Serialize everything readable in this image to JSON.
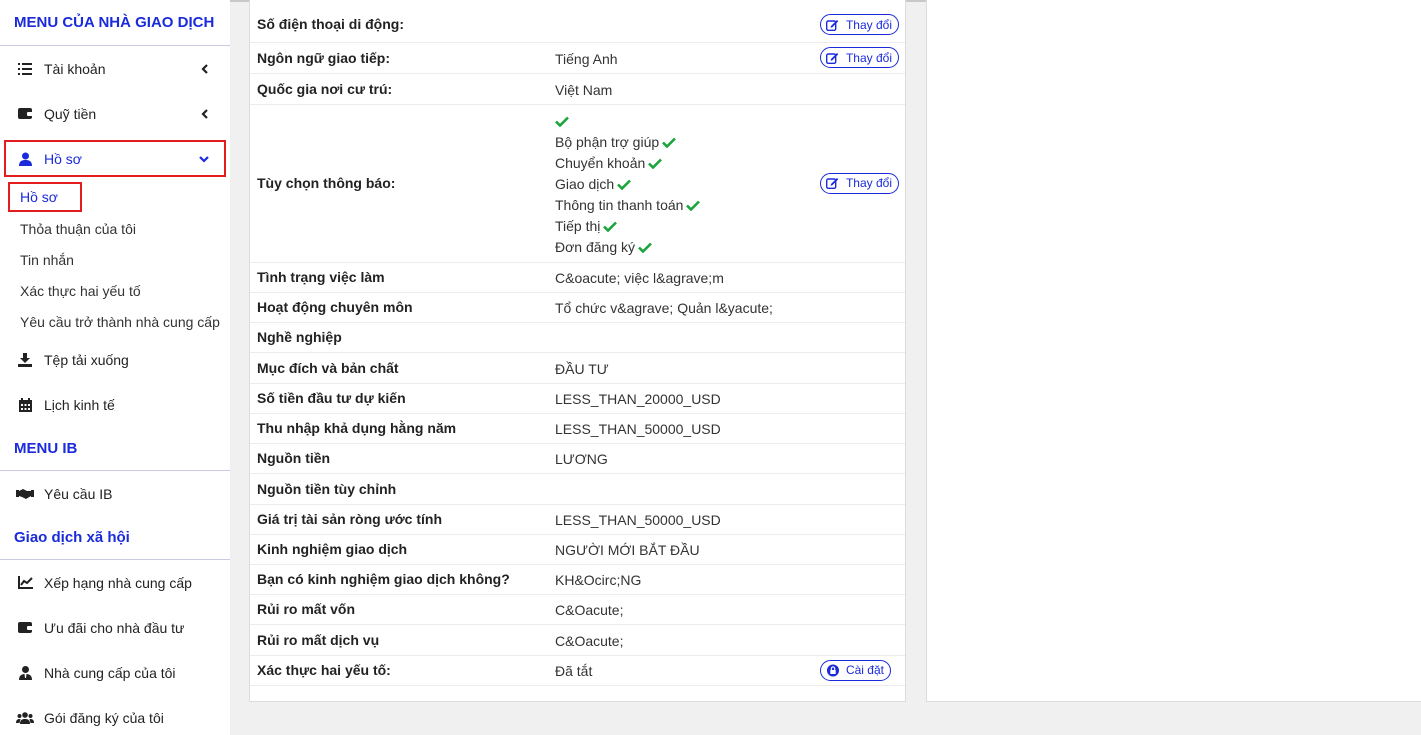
{
  "sidebar": {
    "trader_menu_title": "MENU CỦA NHÀ GIAO DỊCH",
    "items": [
      {
        "label": "Tài khoản",
        "icon": "list-icon"
      },
      {
        "label": "Quỹ tiền",
        "icon": "wallet-icon"
      },
      {
        "label": "Hồ sơ",
        "icon": "user-icon"
      }
    ],
    "profile_sub": [
      {
        "label": "Hồ sơ"
      },
      {
        "label": "Thỏa thuận của tôi"
      },
      {
        "label": "Tin nhắn"
      },
      {
        "label": "Xác thực hai yếu tố"
      },
      {
        "label": "Yêu cầu trở thành nhà cung cấp"
      }
    ],
    "items2": [
      {
        "label": "Tệp tải xuống",
        "icon": "download-icon"
      },
      {
        "label": "Lịch kinh tế",
        "icon": "calendar-icon"
      }
    ],
    "ib_menu_title": "MENU IB",
    "ib_items": [
      {
        "label": "Yêu cầu IB",
        "icon": "handshake-icon"
      }
    ],
    "social_title": "Giao dịch xã hội",
    "social_items": [
      {
        "label": "Xếp hạng nhà cung cấp",
        "icon": "chart-line-icon"
      },
      {
        "label": "Ưu đãi cho nhà đầu tư",
        "icon": "wallet-icon"
      },
      {
        "label": "Nhà cung cấp của tôi",
        "icon": "user-tie-icon"
      },
      {
        "label": "Gói đăng ký của tôi",
        "icon": "users-icon"
      }
    ]
  },
  "profile": {
    "change_label": "Thay đổi",
    "setup_label": "Cài đặt",
    "rows": [
      {
        "label": "Số điện thoại di động:",
        "value": ""
      },
      {
        "label": "Ngôn ngữ giao tiếp:",
        "value": "Tiếng Anh"
      },
      {
        "label": "Quốc gia nơi cư trú:",
        "value": "Việt Nam"
      },
      {
        "label": "Tùy chọn thông báo:",
        "value": ""
      },
      {
        "label": "Tình trạng việc làm",
        "value": "C&oacute; việc l&agrave;m"
      },
      {
        "label": "Hoạt động chuyên môn",
        "value": "Tổ chức v&agrave; Quản l&yacute;"
      },
      {
        "label": "Nghề nghiệp",
        "value": ""
      },
      {
        "label": "Mục đích và bản chất",
        "value": "ĐẦU TƯ"
      },
      {
        "label": "Số tiền đầu tư dự kiến",
        "value": "LESS_THAN_20000_USD"
      },
      {
        "label": "Thu nhập khả dụng hằng năm",
        "value": "LESS_THAN_50000_USD"
      },
      {
        "label": "Nguồn tiền",
        "value": "LƯƠNG"
      },
      {
        "label": "Nguồn tiền tùy chỉnh",
        "value": ""
      },
      {
        "label": "Giá trị tài sản ròng ước tính",
        "value": "LESS_THAN_50000_USD"
      },
      {
        "label": "Kinh nghiệm giao dịch",
        "value": "NGƯỜI MỚI BẮT ĐẦU"
      },
      {
        "label": "Bạn có kinh nghiệm giao dịch không?",
        "value": "KH&Ocirc;NG"
      },
      {
        "label": "Rủi ro mất vốn",
        "value": "C&Oacute;"
      },
      {
        "label": "Rủi ro mất dịch vụ",
        "value": "C&Oacute;"
      },
      {
        "label": "Xác thực hai yếu tố:",
        "value": "Đã tắt"
      }
    ],
    "notifications": [
      {
        "label": ""
      },
      {
        "label": "Bộ phận trợ giúp"
      },
      {
        "label": "Chuyển khoản"
      },
      {
        "label": "Giao dịch"
      },
      {
        "label": "Thông tin thanh toán"
      },
      {
        "label": "Tiếp thị"
      },
      {
        "label": "Đơn đăng ký"
      }
    ]
  },
  "colors": {
    "accent": "#1a2bdb",
    "highlight": "#e31d1d",
    "check": "#1aa53a"
  }
}
